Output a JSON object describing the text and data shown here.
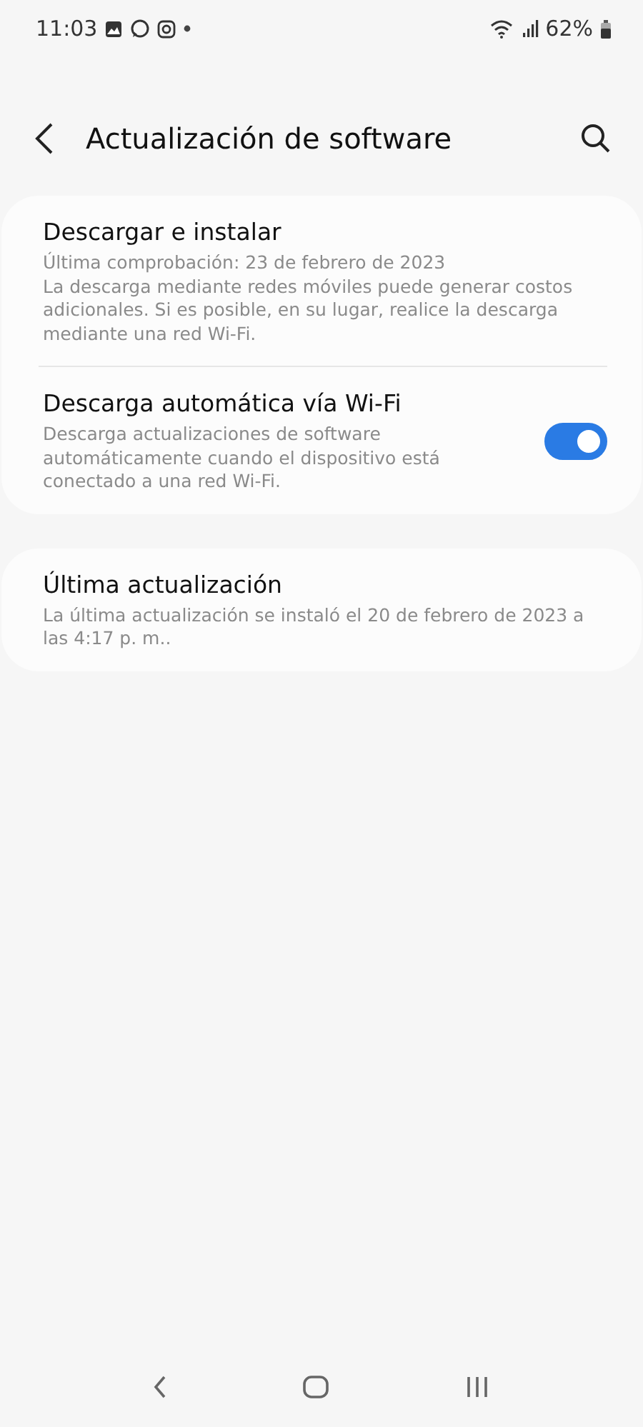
{
  "status_bar": {
    "time": "11:03",
    "battery": "62%"
  },
  "header": {
    "title": "Actualización de software"
  },
  "cards": [
    {
      "items": [
        {
          "kind": "plain",
          "title": "Descargar e instalar",
          "lines": [
            "Última comprobación: 23 de febrero de 2023",
            "La descarga mediante redes móviles puede generar costos adicionales. Si es posible, en su lugar, realice la descarga mediante una red Wi-Fi."
          ]
        },
        {
          "kind": "toggle",
          "title": "Descarga automática vía Wi-Fi",
          "lines": [
            "Descarga actualizaciones de software automáticamente cuando el dispositivo está conectado a una red Wi-Fi."
          ],
          "on": true
        }
      ]
    },
    {
      "items": [
        {
          "kind": "plain",
          "title": "Última actualización",
          "lines": [
            "La última actualización se instaló el 20 de febrero de 2023 a las 4:17 p. m.."
          ]
        }
      ]
    }
  ]
}
